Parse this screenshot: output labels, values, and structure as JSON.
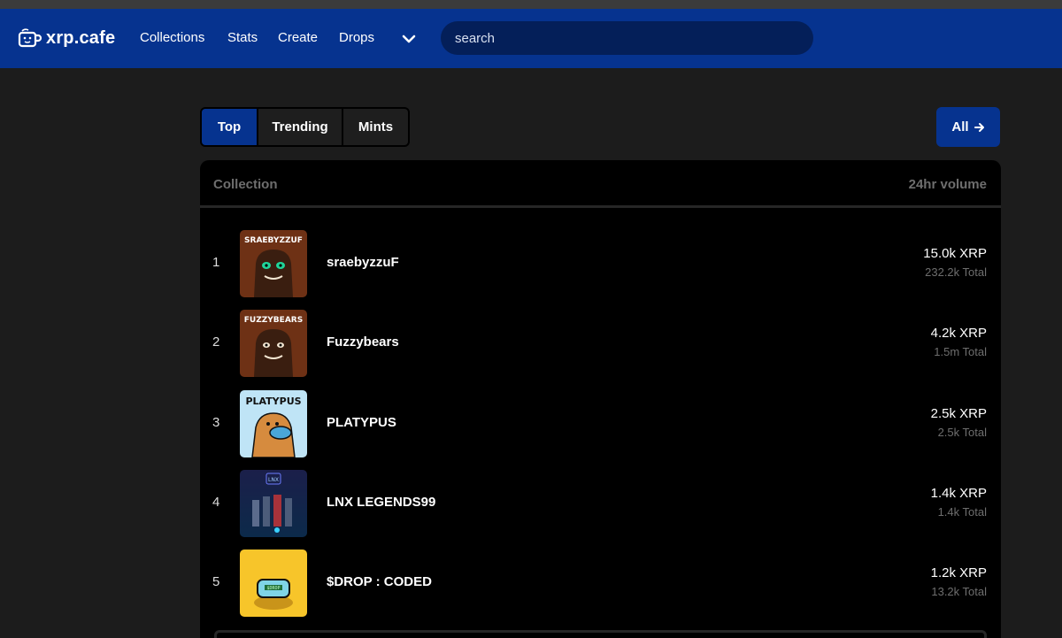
{
  "nav": {
    "logo_text": "xrp.cafe",
    "links": [
      "Collections",
      "Stats",
      "Create",
      "Drops"
    ],
    "search_placeholder": "search"
  },
  "tabs": [
    "Top",
    "Trending",
    "Mints"
  ],
  "active_tab": "Top",
  "all_button": {
    "label": "All",
    "icon": "arrow-right-icon"
  },
  "table": {
    "col_collection": "Collection",
    "col_volume": "24hr volume",
    "rows": [
      {
        "rank": "1",
        "name": "sraebyzzuF",
        "volume": "15.0k XRP",
        "total": "232.2k Total",
        "thumb_text": "SRAEBYZZUF"
      },
      {
        "rank": "2",
        "name": "Fuzzybears",
        "volume": "4.2k XRP",
        "total": "1.5m Total",
        "thumb_text": "FUZZYBEARS"
      },
      {
        "rank": "3",
        "name": "PLATYPUS",
        "volume": "2.5k XRP",
        "total": "2.5k Total",
        "thumb_text": "PLATYPUS"
      },
      {
        "rank": "4",
        "name": "LNX LEGENDS99",
        "volume": "1.4k XRP",
        "total": "1.4k Total",
        "thumb_text": "LNX"
      },
      {
        "rank": "5",
        "name": "$DROP : CODED",
        "volume": "1.2k XRP",
        "total": "13.2k Total",
        "thumb_text": "$DROP"
      }
    ]
  },
  "colors": {
    "brand": "#06338f",
    "background": "#1c1c1c",
    "panel": "#000000"
  }
}
